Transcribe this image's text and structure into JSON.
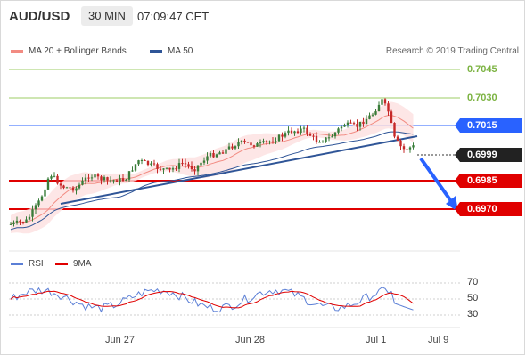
{
  "header": {
    "symbol": "AUD/USD",
    "timeframe": "30 MIN",
    "time": "07:09:47 CET"
  },
  "legend": {
    "ma20_bb": "MA 20 + Bollinger Bands",
    "ma50": "MA 50",
    "copyright": "Research © 2019 Trading Central"
  },
  "rsi_legend": {
    "rsi": "RSI",
    "ma9": "9MA"
  },
  "price_levels": [
    {
      "value": "0.7045",
      "style": "plain"
    },
    {
      "value": "0.7030",
      "style": "plain"
    },
    {
      "value": "0.7015",
      "style": "blue"
    },
    {
      "value": "0.6999",
      "style": "dark"
    },
    {
      "value": "0.6985",
      "style": "red"
    },
    {
      "value": "0.6970",
      "style": "red"
    }
  ],
  "rsi_levels": [
    "70",
    "50",
    "30"
  ],
  "x_labels": [
    "Jun 27",
    "Jun 28",
    "Jul 1",
    "Jul 9"
  ],
  "colors": {
    "resistance": "#9ccc65",
    "pivot": "#2962ff",
    "support": "#e00000",
    "up_candle": "#3a7d3a",
    "down_candle": "#c62828",
    "bollinger_fill": "#fde0e0",
    "ma20": "#f28b82",
    "ma50": "#2f5597",
    "rsi": "#5b7fd6",
    "ma9": "#e00000"
  }
}
